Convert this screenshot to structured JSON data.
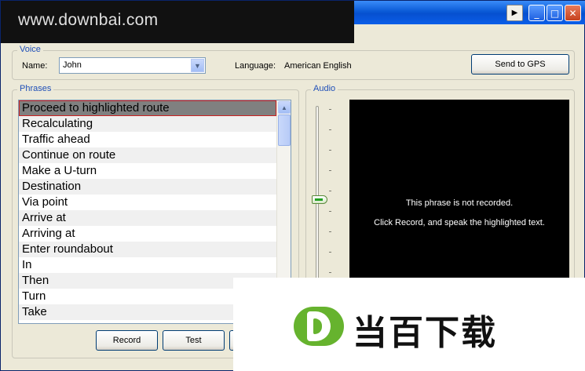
{
  "watermark_top": {
    "text": "www.downbai.com"
  },
  "voice": {
    "group_label": "Voice",
    "name_label": "Name:",
    "name_value": "John",
    "language_label": "Language:",
    "language_value": "American English",
    "send_button": "Send to GPS"
  },
  "phrases": {
    "group_label": "Phrases",
    "selected_index": 0,
    "items": [
      "Proceed to highlighted route",
      "Recalculating",
      "Traffic ahead",
      "Continue on route",
      "Make a U-turn",
      "Destination",
      "Via point",
      "Arrive at",
      "Arriving at",
      "Enter roundabout",
      "In",
      "Then",
      "Turn",
      "Take"
    ]
  },
  "audio": {
    "group_label": "Audio",
    "message_line1": "This phrase is not recorded.",
    "message_line2": "Click Record, and speak the highlighted text.",
    "volume_level": 0.5
  },
  "buttons": {
    "record": "Record",
    "test": "Test"
  },
  "watermark_bottom": {
    "text": "当百下载",
    "logo_color": "#66b32e"
  }
}
